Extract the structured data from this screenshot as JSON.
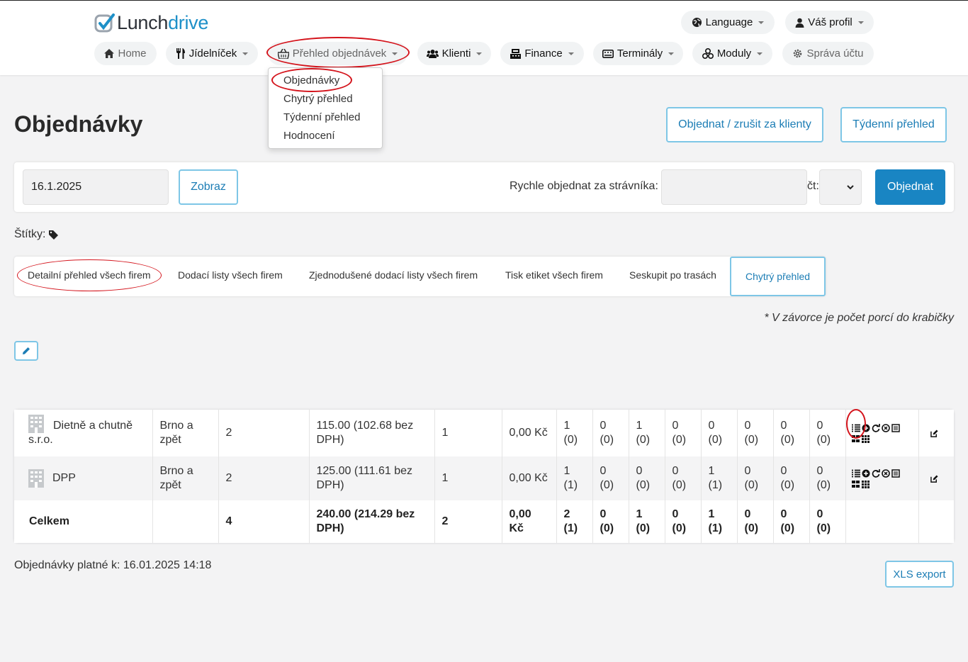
{
  "brand": {
    "name_part1": "Lunch",
    "name_part2": "drive",
    "accent_color": "#1e90c8"
  },
  "header": {
    "language": "Language",
    "profile": "Váš profil",
    "nav": [
      {
        "label": "Home",
        "icon": "home-icon"
      },
      {
        "label": "Jídelníček",
        "icon": "cutlery-icon"
      },
      {
        "label": "Přehled objednávek",
        "icon": "basket-icon"
      },
      {
        "label": "Klienti",
        "icon": "users-icon"
      },
      {
        "label": "Finance",
        "icon": "cash-register-icon"
      },
      {
        "label": "Terminály",
        "icon": "keyboard-icon"
      },
      {
        "label": "Moduly",
        "icon": "cubes-icon"
      },
      {
        "label": "Správa účtu",
        "icon": "gear-icon"
      }
    ]
  },
  "dropdown": {
    "items": [
      "Objednávky",
      "Chytrý přehled",
      "Týdenní přehled",
      "Hodnocení"
    ]
  },
  "page": {
    "title": "Objednávky",
    "btn_order_cancel": "Objednat / zrušit za klienty",
    "btn_weekly": "Týdenní přehled"
  },
  "filter": {
    "date_value": "16.1.2025",
    "show_button": "Zobraz",
    "quick_order_label": "Rychle objednat za strávníka:",
    "quick_order_value": "",
    "day_label": "čt:",
    "select_value": "",
    "order_button": "Objednat"
  },
  "tags_label": "Štítky:",
  "tabs": [
    "Detailní přehled všech firem",
    "Dodací listy všech firem",
    "Zjednodušené dodací listy všech firem",
    "Tisk etiket všech firem",
    "Seskupit po trasách",
    "Chytrý přehled"
  ],
  "note": "* V závorce je počet porcí do krabičky",
  "table": {
    "rows": [
      {
        "company": "Dietně a chutně s.r.o.",
        "route": "Brno a zpět",
        "count": "2",
        "price": "115.00 (102.68 bez DPH)",
        "qty": "1",
        "amount": "0,00 Kč",
        "meals": [
          [
            "1",
            "(0)"
          ],
          [
            "0",
            "(0)"
          ],
          [
            "1",
            "(0)"
          ],
          [
            "0",
            "(0)"
          ],
          [
            "0",
            "(0)"
          ],
          [
            "0",
            "(0)"
          ],
          [
            "0",
            "(0)"
          ],
          [
            "0",
            "(0)"
          ]
        ]
      },
      {
        "company": "DPP",
        "route": "Brno a zpět",
        "count": "2",
        "price": "125.00 (111.61 bez DPH)",
        "qty": "1",
        "amount": "0,00 Kč",
        "meals": [
          [
            "1",
            "(1)"
          ],
          [
            "0",
            "(0)"
          ],
          [
            "0",
            "(0)"
          ],
          [
            "0",
            "(0)"
          ],
          [
            "1",
            "(1)"
          ],
          [
            "0",
            "(0)"
          ],
          [
            "0",
            "(0)"
          ],
          [
            "0",
            "(0)"
          ]
        ]
      }
    ],
    "total": {
      "label": "Celkem",
      "count": "4",
      "price": "240.00 (214.29 bez DPH)",
      "qty": "2",
      "amount": "0,00 Kč",
      "meals": [
        [
          "2",
          "(1)"
        ],
        [
          "0",
          "(0)"
        ],
        [
          "1",
          "(0)"
        ],
        [
          "0",
          "(0)"
        ],
        [
          "1",
          "(1)"
        ],
        [
          "0",
          "(0)"
        ],
        [
          "0",
          "(0)"
        ],
        [
          "0",
          "(0)"
        ]
      ]
    }
  },
  "footer": {
    "valid_text": "Objednávky platné k: 16.01.2025 14:18",
    "xls_button": "XLS export"
  }
}
